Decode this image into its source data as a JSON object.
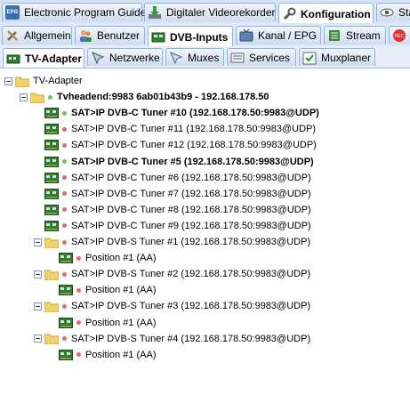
{
  "tabs_row1": [
    {
      "label": "Electronic Program Guide",
      "icon": "epg-icon",
      "active": false
    },
    {
      "label": "Digitaler Videorekorder",
      "icon": "dvr-download-icon",
      "active": false
    },
    {
      "label": "Konfiguration",
      "icon": "wrench-icon",
      "active": true
    },
    {
      "label": "Sta",
      "icon": "eye-icon",
      "active": false
    }
  ],
  "tabs_row2": [
    {
      "label": "Allgemein",
      "icon": "tools-icon",
      "active": false
    },
    {
      "label": "Benutzer",
      "icon": "users-icon",
      "active": false
    },
    {
      "label": "DVB-Inputs",
      "icon": "dvb-card-icon",
      "active": true
    },
    {
      "label": "Kanal / EPG",
      "icon": "tv-icon",
      "active": false
    },
    {
      "label": "Stream",
      "icon": "stream-icon",
      "active": false
    },
    {
      "label": "",
      "icon": "record-icon",
      "active": false
    }
  ],
  "tabs_row3": [
    {
      "label": "TV-Adapter",
      "icon": "adapter-icon",
      "active": true
    },
    {
      "label": "Netzwerke",
      "icon": "network-icon",
      "active": false
    },
    {
      "label": "Muxes",
      "icon": "muxes-icon",
      "active": false
    },
    {
      "label": "Services",
      "icon": "services-icon",
      "active": false
    },
    {
      "label": "Muxplaner",
      "icon": "muxplaner-icon",
      "active": false
    }
  ],
  "tree": {
    "root": "TV-Adapter",
    "server": "Tvheadend:9983 6ab01b43b9 - 192.168.178.50",
    "server_status": "green",
    "tuners": [
      {
        "label": "SAT>IP DVB-C Tuner #10 (192.168.178.50:9983@UDP)",
        "status": "green",
        "bold": true,
        "children": []
      },
      {
        "label": "SAT>IP DVB-C Tuner #11 (192.168.178.50:9983@UDP)",
        "status": "red",
        "bold": false,
        "children": []
      },
      {
        "label": "SAT>IP DVB-C Tuner #12 (192.168.178.50:9983@UDP)",
        "status": "red",
        "bold": false,
        "children": []
      },
      {
        "label": "SAT>IP DVB-C Tuner #5 (192.168.178.50:9983@UDP)",
        "status": "green",
        "bold": true,
        "children": []
      },
      {
        "label": "SAT>IP DVB-C Tuner #6 (192.168.178.50:9983@UDP)",
        "status": "red",
        "bold": false,
        "children": []
      },
      {
        "label": "SAT>IP DVB-C Tuner #7 (192.168.178.50:9983@UDP)",
        "status": "red",
        "bold": false,
        "children": []
      },
      {
        "label": "SAT>IP DVB-C Tuner #8 (192.168.178.50:9983@UDP)",
        "status": "red",
        "bold": false,
        "children": []
      },
      {
        "label": "SAT>IP DVB-C Tuner #9 (192.168.178.50:9983@UDP)",
        "status": "red",
        "bold": false,
        "children": []
      },
      {
        "label": "SAT>IP DVB-S Tuner #1 (192.168.178.50:9983@UDP)",
        "status": "red",
        "bold": false,
        "children": [
          "Position #1 (AA)"
        ]
      },
      {
        "label": "SAT>IP DVB-S Tuner #2 (192.168.178.50:9983@UDP)",
        "status": "red",
        "bold": false,
        "children": [
          "Position #1 (AA)"
        ]
      },
      {
        "label": "SAT>IP DVB-S Tuner #3 (192.168.178.50:9983@UDP)",
        "status": "red",
        "bold": false,
        "children": [
          "Position #1 (AA)"
        ]
      },
      {
        "label": "SAT>IP DVB-S Tuner #4 (192.168.178.50:9983@UDP)",
        "status": "red",
        "bold": false,
        "children": [
          "Position #1 (AA)"
        ]
      }
    ]
  },
  "colors": {
    "ok": "#6dc35b",
    "error": "#e06a6a",
    "accent": "#99bbe8"
  }
}
